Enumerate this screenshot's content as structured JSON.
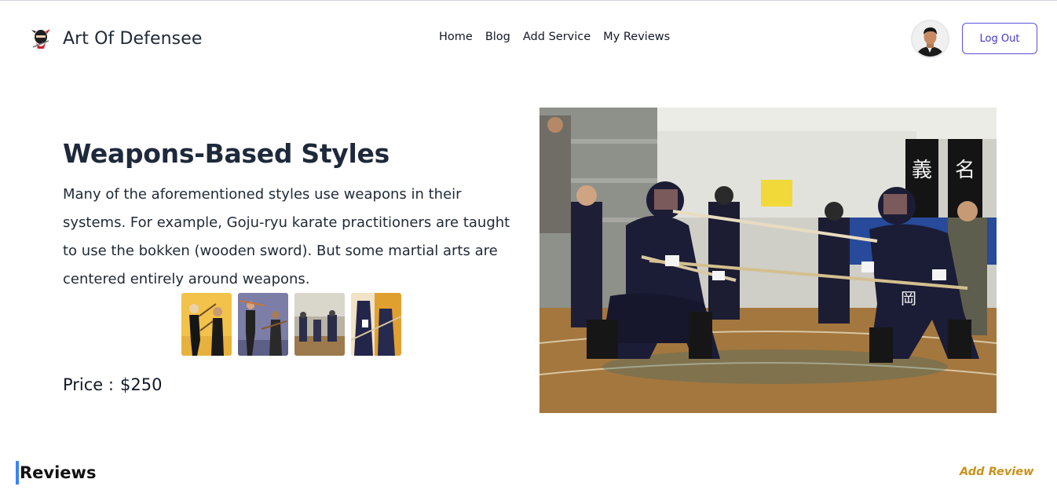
{
  "brand": {
    "name": "Art Of Defensee",
    "logo_icon": "ninja-logo-icon"
  },
  "nav": {
    "items": [
      {
        "label": "Home"
      },
      {
        "label": "Blog"
      },
      {
        "label": "Add Service"
      },
      {
        "label": "My Reviews"
      }
    ],
    "logout_label": "Log Out"
  },
  "service": {
    "title": "Weapons-Based Styles",
    "description": "Many of the aforementioned styles use weapons in their systems. For example, Goju-ryu karate practitioners are taught to use the bokken (wooden sword). But some martial arts are centered entirely around weapons.",
    "price_label": "Price :",
    "price_value": "$250",
    "thumbnails": [
      "stick-fighting-photo",
      "bo-staff-photo",
      "kendo-hall-photo",
      "kendo-closeup-photo"
    ],
    "main_image": "kendo-match-photo"
  },
  "reviews": {
    "title": "Reviews",
    "add_label": "Add Review"
  },
  "colors": {
    "accent_blue": "#3b82f6",
    "logout_border": "#5b52d6",
    "add_review": "#c8911b"
  }
}
